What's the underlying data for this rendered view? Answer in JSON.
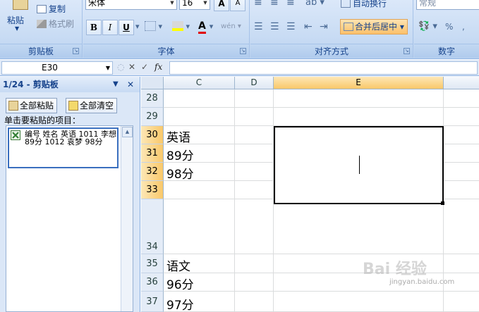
{
  "ribbon": {
    "clipboard": {
      "paste_label": "粘贴",
      "copy_label": "复制",
      "format_painter_label": "格式刷",
      "group_label": "剪贴板"
    },
    "font": {
      "font_name": "宋体",
      "font_size": "16",
      "grow_label": "A",
      "shrink_label": "A",
      "bold_label": "B",
      "italic_label": "I",
      "underline_label": "U",
      "font_color_label": "A",
      "phonetic_label": "wén",
      "group_label": "字体"
    },
    "alignment": {
      "wrap_text_label": "自动换行",
      "merge_center_label": "合并后居中",
      "group_label": "对齐方式"
    },
    "number": {
      "format_value": "常规",
      "percent_label": "%",
      "comma_label": ",",
      "group_label": "数字"
    }
  },
  "formula_bar": {
    "name_box": "E30",
    "cancel_glyph": "✕",
    "enter_glyph": "✓",
    "fx_label": "fx",
    "formula": ""
  },
  "clipboard_pane": {
    "title": "1/24 - 剪贴板",
    "paste_all_label": "全部粘贴",
    "clear_all_label": "全部清空",
    "hint": "单击要粘贴的项目：",
    "items": [
      {
        "text": "编号 姓名 英语 1011 李想 89分 1012 袁梦 98分"
      }
    ]
  },
  "sheet": {
    "columns": [
      {
        "label": "C",
        "selected": false
      },
      {
        "label": "D",
        "selected": false
      },
      {
        "label": "E",
        "selected": true
      }
    ],
    "rows": [
      {
        "num": "28",
        "selected": false,
        "c": ""
      },
      {
        "num": "29",
        "selected": false,
        "c": ""
      },
      {
        "num": "30",
        "selected": true,
        "c": "英语"
      },
      {
        "num": "31",
        "selected": true,
        "c": "89分"
      },
      {
        "num": "32",
        "selected": true,
        "c": "98分"
      },
      {
        "num": "33",
        "selected": true,
        "c": ""
      },
      {
        "num": "34",
        "selected": false,
        "c": ""
      },
      {
        "num": "35",
        "selected": false,
        "c": "语文"
      },
      {
        "num": "36",
        "selected": false,
        "c": "96分"
      },
      {
        "num": "37",
        "selected": false,
        "c": "97分"
      }
    ]
  },
  "watermark": {
    "main": "Bai 经验",
    "sub": "jingyan.baidu.com"
  },
  "colors": {
    "selection_accent": "#f9c86a",
    "ribbon_text": "#15428b"
  }
}
